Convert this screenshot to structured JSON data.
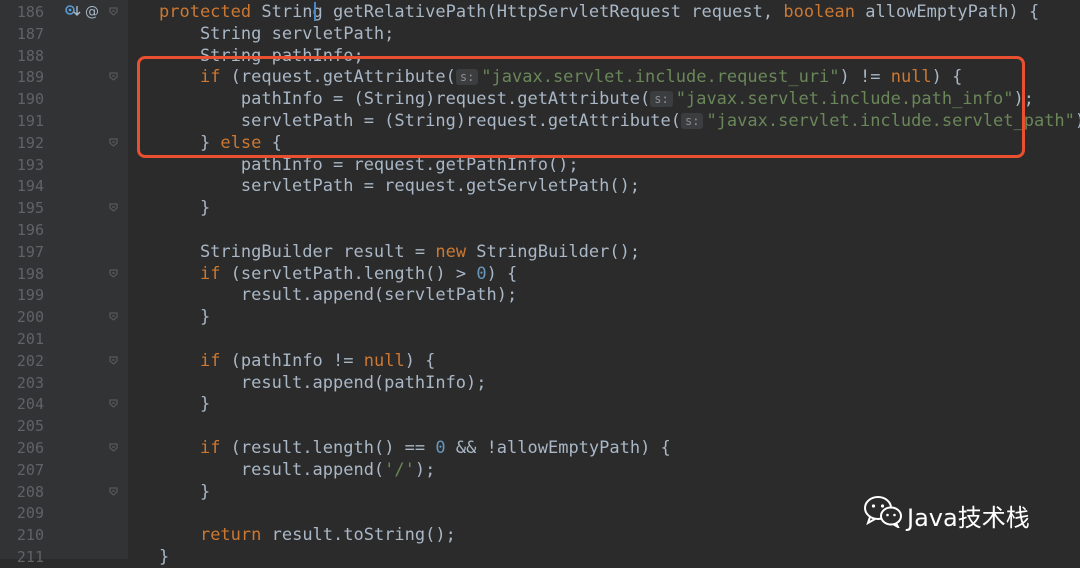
{
  "editor": {
    "language": "java",
    "lines": [
      {
        "number": "186",
        "tokens": [
          {
            "t": "protected",
            "c": "kw"
          },
          {
            "t": " String ",
            "c": "plain"
          },
          {
            "t": "getRelativePath",
            "c": "plain"
          },
          {
            "t": "(HttpServletRequest request, ",
            "c": "plain"
          },
          {
            "t": "boolean",
            "c": "kw"
          },
          {
            "t": " allowEmptyPath) {",
            "c": "plain"
          }
        ]
      },
      {
        "number": "187",
        "tokens": [
          {
            "t": "    String servletPath;",
            "c": "plain"
          }
        ]
      },
      {
        "number": "188",
        "tokens": [
          {
            "t": "    String pathInfo;",
            "c": "plain"
          }
        ]
      },
      {
        "number": "189",
        "tokens": [
          {
            "t": "    ",
            "c": "plain"
          },
          {
            "t": "if",
            "c": "kw"
          },
          {
            "t": " (request.getAttribute(",
            "c": "plain"
          },
          {
            "hint": "s:"
          },
          {
            "t": "\"javax.servlet.include.request_uri\"",
            "c": "str"
          },
          {
            "t": ") != ",
            "c": "plain"
          },
          {
            "t": "null",
            "c": "kw"
          },
          {
            "t": ") {",
            "c": "plain"
          }
        ]
      },
      {
        "number": "190",
        "tokens": [
          {
            "t": "        pathInfo = (String)request.getAttribute(",
            "c": "plain"
          },
          {
            "hint": "s:"
          },
          {
            "t": "\"javax.servlet.include.path_info\"",
            "c": "str"
          },
          {
            "t": ");",
            "c": "plain"
          }
        ]
      },
      {
        "number": "191",
        "tokens": [
          {
            "t": "        servletPath = (String)request.getAttribute(",
            "c": "plain"
          },
          {
            "hint": "s:"
          },
          {
            "t": "\"javax.servlet.include.servlet_path\"",
            "c": "str"
          },
          {
            "t": ");",
            "c": "plain"
          }
        ]
      },
      {
        "number": "192",
        "tokens": [
          {
            "t": "    } ",
            "c": "plain"
          },
          {
            "t": "else",
            "c": "kw"
          },
          {
            "t": " {",
            "c": "plain"
          }
        ]
      },
      {
        "number": "193",
        "tokens": [
          {
            "t": "        pathInfo = request.getPathInfo();",
            "c": "plain"
          }
        ]
      },
      {
        "number": "194",
        "tokens": [
          {
            "t": "        servletPath = request.getServletPath();",
            "c": "plain"
          }
        ]
      },
      {
        "number": "195",
        "tokens": [
          {
            "t": "    }",
            "c": "plain"
          }
        ]
      },
      {
        "number": "196",
        "tokens": []
      },
      {
        "number": "197",
        "tokens": [
          {
            "t": "    StringBuilder result = ",
            "c": "plain"
          },
          {
            "t": "new",
            "c": "kw"
          },
          {
            "t": " StringBuilder();",
            "c": "plain"
          }
        ]
      },
      {
        "number": "198",
        "tokens": [
          {
            "t": "    ",
            "c": "plain"
          },
          {
            "t": "if",
            "c": "kw"
          },
          {
            "t": " (servletPath.length() > ",
            "c": "plain"
          },
          {
            "t": "0",
            "c": "num"
          },
          {
            "t": ") {",
            "c": "plain"
          }
        ]
      },
      {
        "number": "199",
        "tokens": [
          {
            "t": "        result.append(servletPath);",
            "c": "plain"
          }
        ]
      },
      {
        "number": "200",
        "tokens": [
          {
            "t": "    }",
            "c": "plain"
          }
        ]
      },
      {
        "number": "201",
        "tokens": []
      },
      {
        "number": "202",
        "tokens": [
          {
            "t": "    ",
            "c": "plain"
          },
          {
            "t": "if",
            "c": "kw"
          },
          {
            "t": " (pathInfo != ",
            "c": "plain"
          },
          {
            "t": "null",
            "c": "kw"
          },
          {
            "t": ") {",
            "c": "plain"
          }
        ]
      },
      {
        "number": "203",
        "tokens": [
          {
            "t": "        result.append(pathInfo);",
            "c": "plain"
          }
        ]
      },
      {
        "number": "204",
        "tokens": [
          {
            "t": "    }",
            "c": "plain"
          }
        ]
      },
      {
        "number": "205",
        "tokens": []
      },
      {
        "number": "206",
        "tokens": [
          {
            "t": "    ",
            "c": "plain"
          },
          {
            "t": "if",
            "c": "kw"
          },
          {
            "t": " (result.length() == ",
            "c": "plain"
          },
          {
            "t": "0",
            "c": "num"
          },
          {
            "t": " && !allowEmptyPath) {",
            "c": "plain"
          }
        ]
      },
      {
        "number": "207",
        "tokens": [
          {
            "t": "        result.append(",
            "c": "plain"
          },
          {
            "t": "'/'",
            "c": "str"
          },
          {
            "t": ");",
            "c": "plain"
          }
        ]
      },
      {
        "number": "208",
        "tokens": [
          {
            "t": "    }",
            "c": "plain"
          }
        ]
      },
      {
        "number": "209",
        "tokens": []
      },
      {
        "number": "210",
        "tokens": [
          {
            "t": "    ",
            "c": "plain"
          },
          {
            "t": "return",
            "c": "kw"
          },
          {
            "t": " result.toString();",
            "c": "plain"
          }
        ]
      },
      {
        "number": "211",
        "tokens": [
          {
            "t": "}",
            "c": "plain"
          }
        ]
      }
    ],
    "fold_marker_lines": [
      "186",
      "189",
      "192",
      "195",
      "198",
      "200",
      "202",
      "204",
      "206",
      "208"
    ],
    "gutter_icons": [
      "implements-icon",
      "override-annotation-icon"
    ]
  },
  "highlight": {
    "color": "#e8502f",
    "covers_lines": [
      "189",
      "190",
      "191",
      "192"
    ]
  },
  "watermark": {
    "text": "Java技术栈",
    "icon": "wechat-icon"
  },
  "colors": {
    "background": "#2b2b2b",
    "gutter": "#313335",
    "keyword": "#cc7832",
    "string": "#6a8759",
    "number": "#6897bb",
    "text": "#a9b7c6",
    "line_number": "#606366"
  }
}
